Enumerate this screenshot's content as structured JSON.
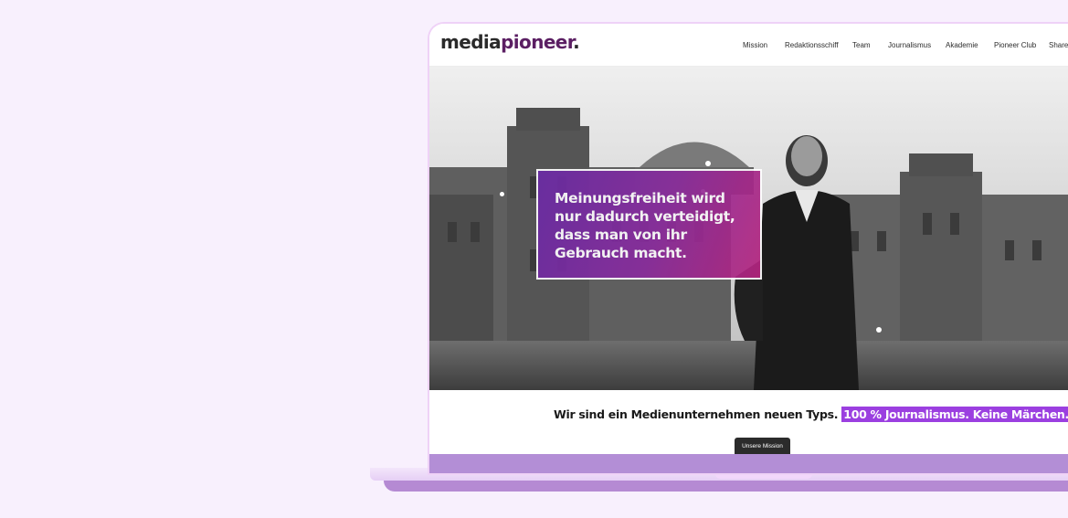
{
  "brand": {
    "logo_part1": "media",
    "logo_part2": "pioneer",
    "logo_dot": "."
  },
  "nav": {
    "items": [
      {
        "label": "Mission"
      },
      {
        "label": "Redaktionsschiff"
      },
      {
        "label": "Team"
      },
      {
        "label": "Journalismus"
      },
      {
        "label": "Akademie"
      },
      {
        "label": "Pioneer Club"
      },
      {
        "label": "Shareh"
      }
    ]
  },
  "hero": {
    "quote": "Meinungsfreiheit wird nur dadurch verteidigt, dass man von ihr Gebrauch macht."
  },
  "tagline": {
    "text": "Wir sind ein Medienunternehmen neuen Typs.",
    "highlight": "100 % Journalismus. Keine Märchen."
  },
  "cta": {
    "label": "Unsere Mission"
  },
  "colors": {
    "background": "#f8f0fd",
    "accent_purple": "#9b3fe0",
    "quote_gradient_start": "#6a2ba6",
    "quote_gradient_end": "#b5257e",
    "button_dark": "#2b2b2b",
    "band_purple": "#b38ed6"
  }
}
